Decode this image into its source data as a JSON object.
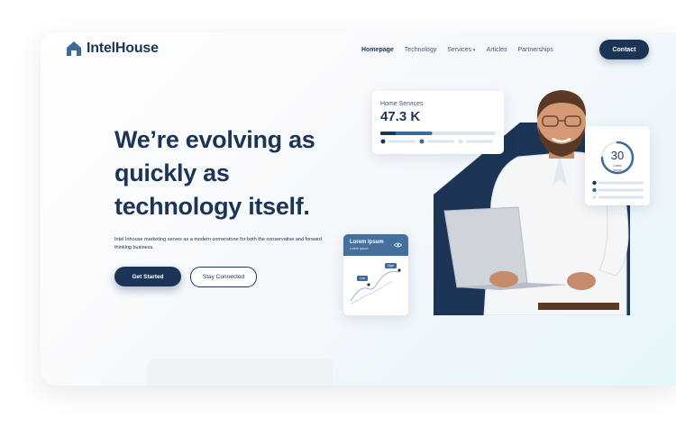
{
  "brand": {
    "name": "IntelHouse",
    "color": "#1c3557",
    "accent": "#3d6a99"
  },
  "nav": {
    "items": [
      {
        "label": "Homepage",
        "active": true
      },
      {
        "label": "Technology",
        "active": false
      },
      {
        "label": "Services",
        "active": false,
        "dropdown": true
      },
      {
        "label": "Articles",
        "active": false
      },
      {
        "label": "Partnerships",
        "active": false
      }
    ],
    "contact_label": "Contact"
  },
  "hero": {
    "headline_lines": [
      "We’re evolving as",
      "quickly as",
      "technology itself."
    ],
    "subtitle": "Intel Inhouse marketing serves as a modern cornerstone for both the conservative and forward thinking business.",
    "primary_cta": "Get Started",
    "secondary_cta": "Stay Connected"
  },
  "widgets": {
    "services": {
      "label": "Home Services",
      "value": "47.3 K",
      "progress": 0.45
    },
    "chart_card": {
      "title": "Lorem Ipsum",
      "subtitle": "Lorem Ipsum",
      "low_label": "Low",
      "high_label": "High",
      "icon": "eye-icon"
    },
    "stat_card": {
      "value": "30",
      "caption_line1": "Lorem",
      "caption_line2": "Ipsum",
      "ring_progress": 0.75
    }
  }
}
